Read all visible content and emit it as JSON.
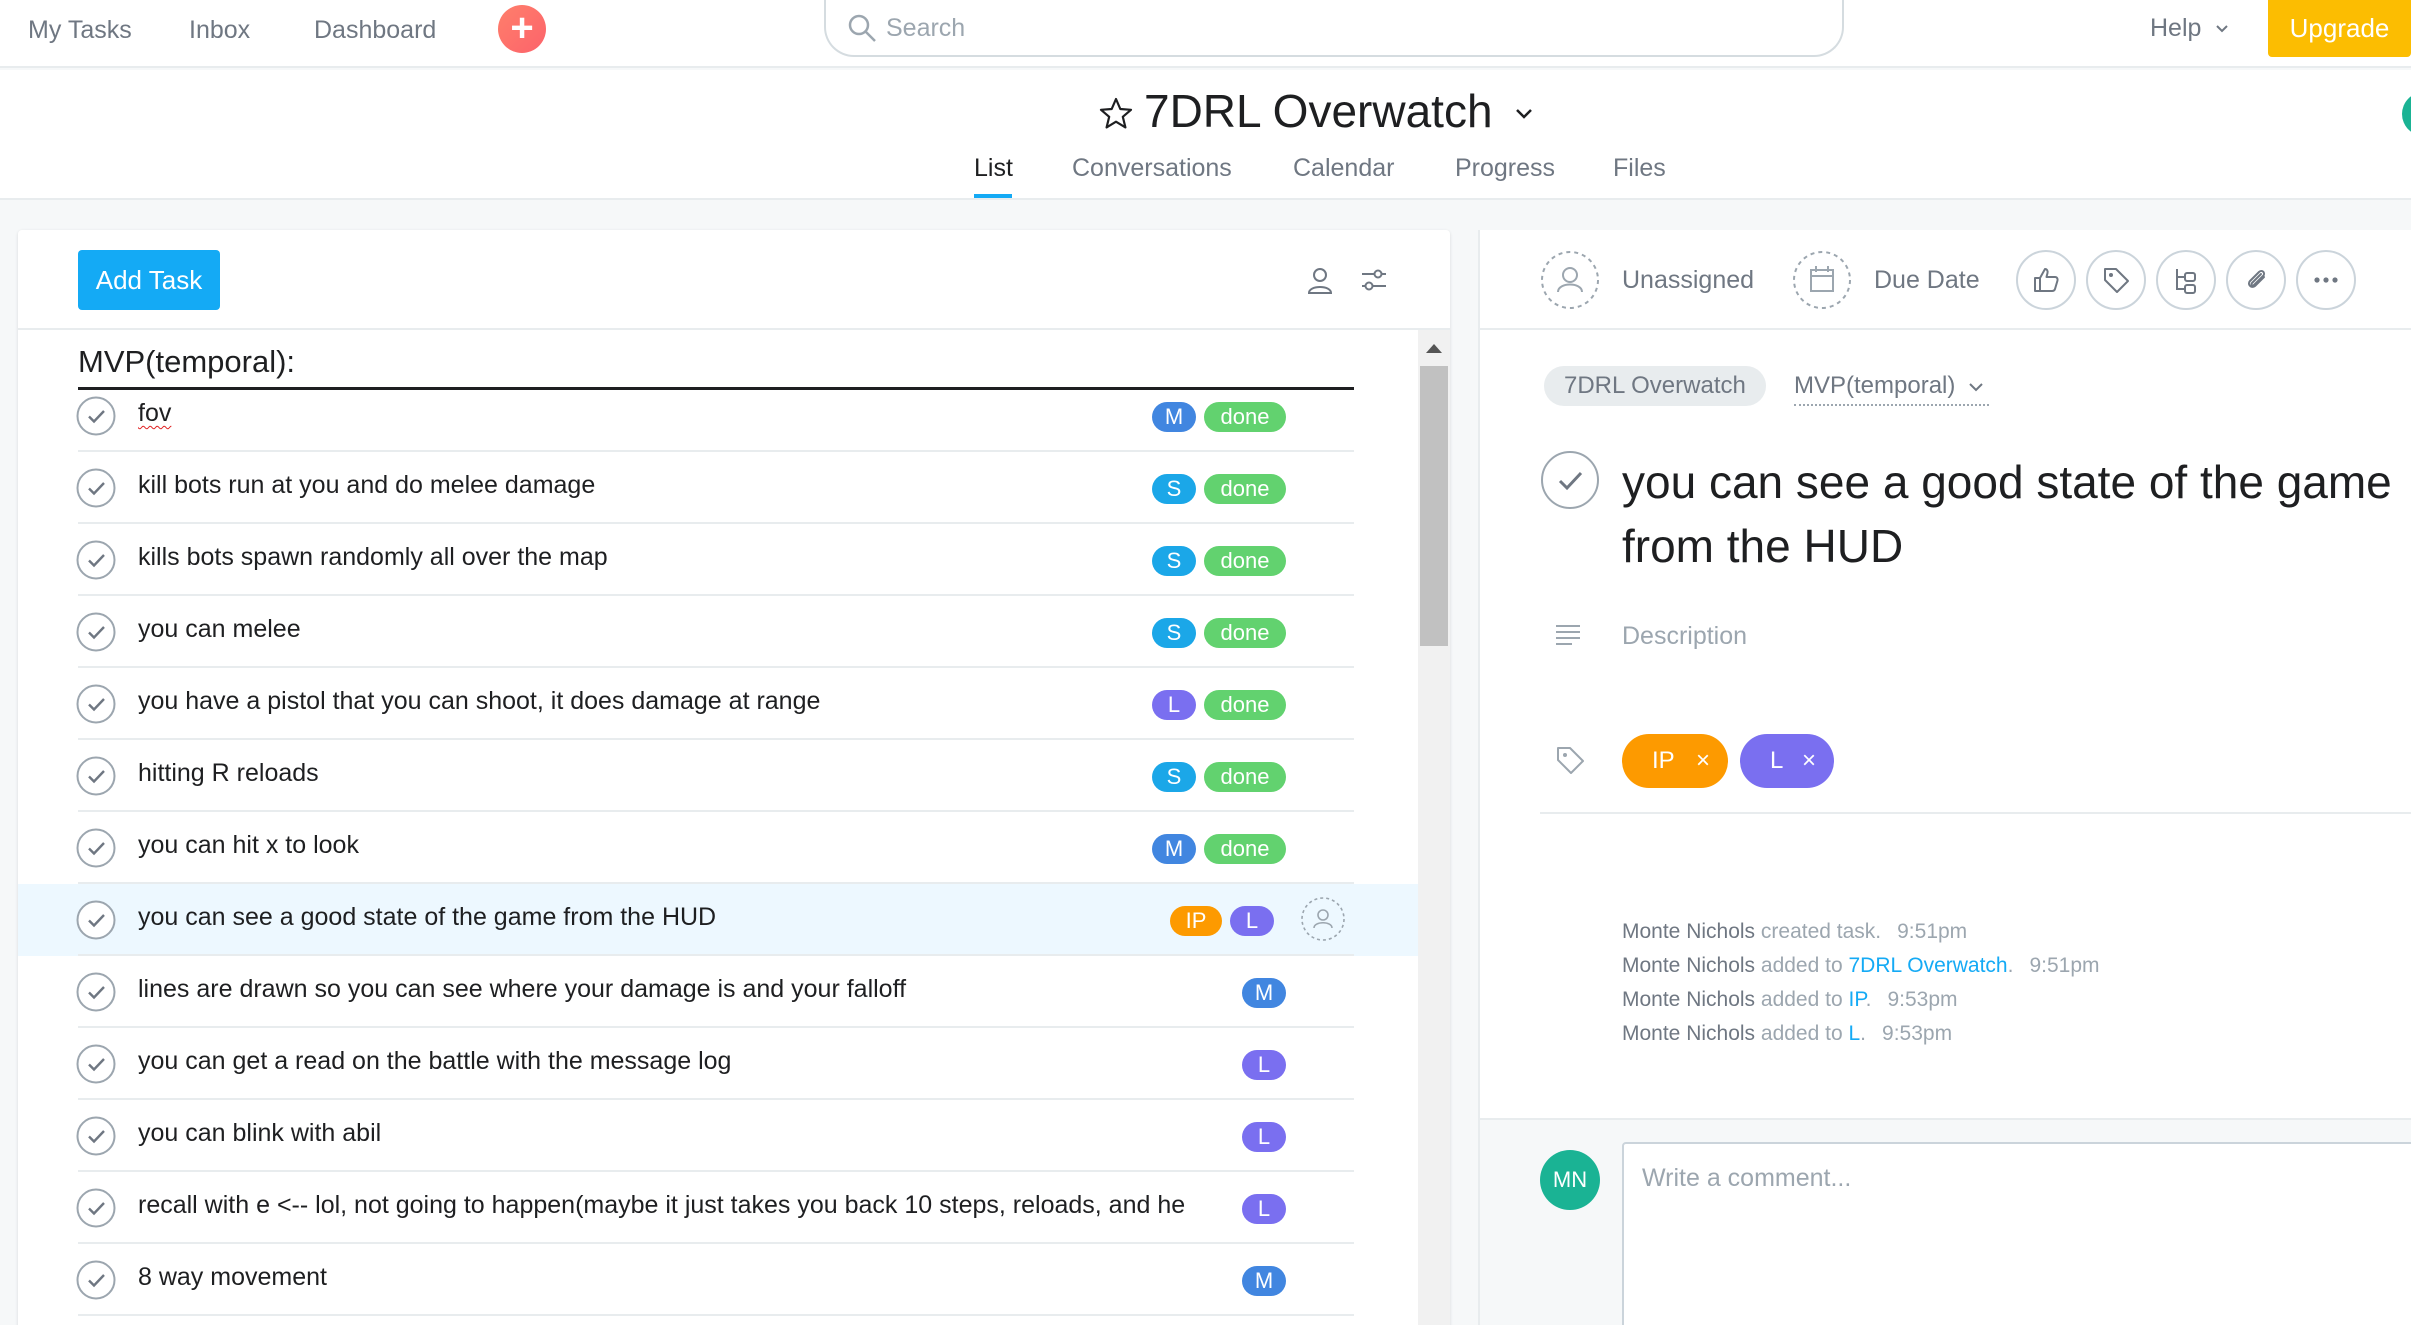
{
  "topbar": {
    "nav": [
      "My Tasks",
      "Inbox",
      "Dashboard"
    ],
    "add_symbol": "+",
    "search_placeholder": "Search",
    "help": "Help",
    "upgrade": "Upgrade"
  },
  "project": {
    "title": "7DRL Overwatch",
    "tabs": [
      "List",
      "Conversations",
      "Calendar",
      "Progress",
      "Files"
    ],
    "active_tab": "List"
  },
  "list": {
    "add_task": "Add Task",
    "section": "MVP(temporal):",
    "rows": [
      {
        "text": "fov",
        "badges": [
          "M"
        ],
        "status": "done"
      },
      {
        "text": "kill bots run at you and do melee damage",
        "badges": [
          "S"
        ],
        "status": "done"
      },
      {
        "text": "kills bots spawn randomly all over the map",
        "badges": [
          "S"
        ],
        "status": "done"
      },
      {
        "text": "you can melee",
        "badges": [
          "S"
        ],
        "status": "done"
      },
      {
        "text": "you have a pistol that you can shoot, it does damage at range",
        "badges": [
          "L"
        ],
        "status": "done"
      },
      {
        "text": "hitting R reloads",
        "badges": [
          "S"
        ],
        "status": "done"
      },
      {
        "text": "you can hit x to look",
        "badges": [
          "M"
        ],
        "status": "done"
      },
      {
        "text": "you can see a good state of the game from the HUD",
        "badges": [
          "IP",
          "L"
        ],
        "status": ""
      },
      {
        "text": "lines are drawn so you can see where your damage is and your falloff",
        "badges": [
          "M"
        ],
        "status": ""
      },
      {
        "text": "you can get a read on the battle with the message log",
        "badges": [
          "L"
        ],
        "status": ""
      },
      {
        "text": "you can blink with abil",
        "badges": [
          "L"
        ],
        "status": ""
      },
      {
        "text": " recall with e <-- lol, not going to happen(maybe it just takes you back 10 steps, reloads, and he",
        "badges": [
          "L"
        ],
        "status": ""
      },
      {
        "text": "8 way movement",
        "badges": [
          "M"
        ],
        "status": ""
      }
    ]
  },
  "detail": {
    "assignee": "Unassigned",
    "due": "Due Date",
    "project_chip": "7DRL Overwatch",
    "section_chip": "MVP(temporal)",
    "title": "you can see a good state of the game from the HUD",
    "description_placeholder": "Description",
    "tags": [
      {
        "label": "IP",
        "color": "#fd9a00"
      },
      {
        "label": "L",
        "color": "#7a6ff0"
      }
    ],
    "tag_remove": "×",
    "story": [
      {
        "who": "Monte Nichols",
        "action": " created task.",
        "link": "",
        "end": "",
        "time": "9:51pm"
      },
      {
        "who": "Monte Nichols",
        "action": " added to ",
        "link": "7DRL Overwatch",
        "end": ".",
        "time": "9:51pm"
      },
      {
        "who": "Monte Nichols",
        "action": " added to ",
        "link": "IP",
        "end": ".",
        "time": "9:53pm"
      },
      {
        "who": "Monte Nichols",
        "action": " added to ",
        "link": "L",
        "end": ".",
        "time": "9:53pm"
      }
    ],
    "commenter_initials": "MN",
    "comment_placeholder": "Write a comment..."
  },
  "colors": {
    "accent": "#14aaf5",
    "badge_M": "#4186e0",
    "badge_S": "#1ba7e8",
    "badge_L": "#7a6ff0",
    "badge_IP": "#fd9a00",
    "done": "#62d26f",
    "upgrade": "#fcbd01",
    "avatar": "#1ab394"
  },
  "icons": [
    "search-icon",
    "star-icon",
    "chevron-down-icon",
    "person-icon",
    "filter-icon",
    "check-icon",
    "calendar-icon",
    "like-icon",
    "tag-icon",
    "subtask-icon",
    "attachment-icon",
    "more-icon",
    "description-icon"
  ]
}
